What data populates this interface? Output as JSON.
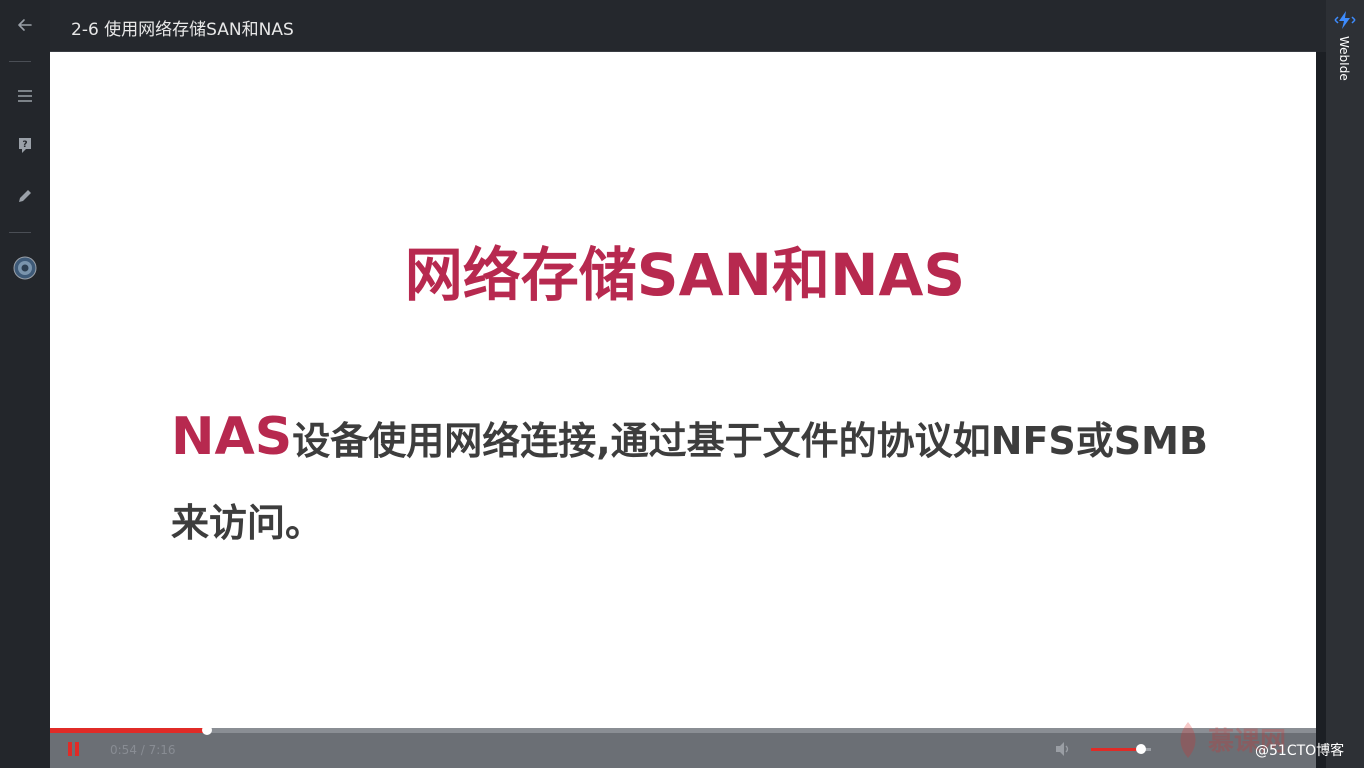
{
  "header": {
    "title": "2-6 使用网络存储SAN和NAS"
  },
  "sidebar": {
    "items": [
      {
        "icon": "back-arrow-icon",
        "name": "back"
      },
      {
        "icon": "menu-icon",
        "name": "catalog"
      },
      {
        "icon": "question-icon",
        "name": "questions"
      },
      {
        "icon": "pencil-icon",
        "name": "notes"
      },
      {
        "icon": "avatar-icon",
        "name": "user"
      }
    ]
  },
  "right_rail": {
    "label": "WebIde"
  },
  "slide": {
    "title": "网络存储SAN和NAS",
    "highlight": "NAS",
    "body_line1": "设备使用网络连接,通过基于文件的协议如NFS或SMB",
    "body_line2": "来访问。"
  },
  "player": {
    "time": "0:54 / 7:16",
    "progress_fraction": 0.124,
    "volume_fraction": 0.83
  },
  "watermark": {
    "logo_text": "慕课网",
    "credit": "@51CTO博客"
  },
  "colors": {
    "accent": "#e02b27",
    "slide_title": "#b7294f",
    "slide_text": "#3d3d3d",
    "background": "#1c1f24"
  }
}
